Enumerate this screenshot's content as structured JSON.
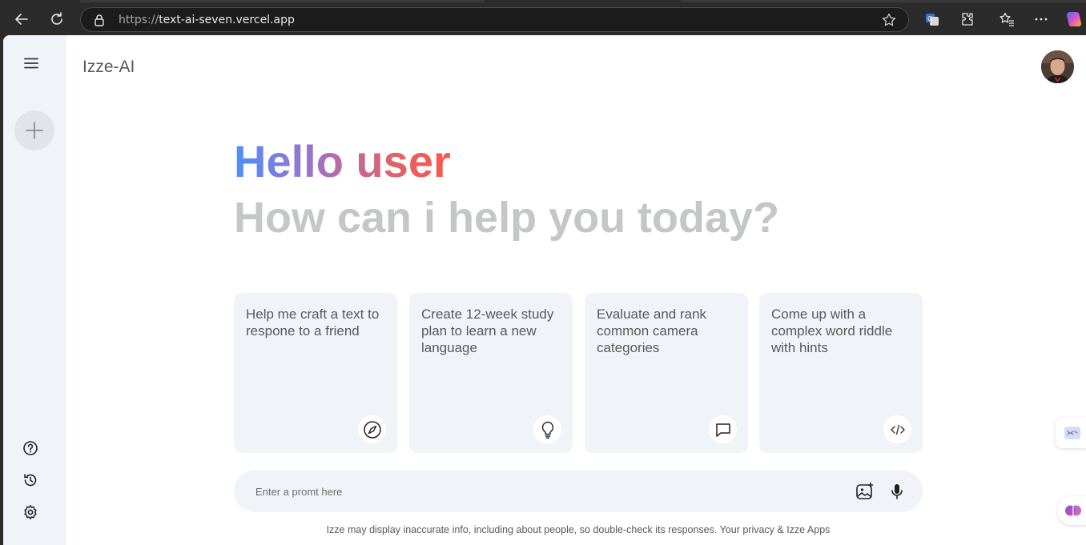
{
  "browser": {
    "url_protocol": "https://",
    "url_host": "text-ai-seven.vercel.app"
  },
  "app": {
    "brand": "Izze-AI"
  },
  "greeting": {
    "hello": "Hello user",
    "subtitle": "How can i help you today?"
  },
  "cards": [
    {
      "text": "Help me craft a text to respone to a friend",
      "icon": "compass-icon"
    },
    {
      "text": "Create 12-week study plan to learn a new language",
      "icon": "bulb-icon"
    },
    {
      "text": "Evaluate and rank common camera categories",
      "icon": "message-icon"
    },
    {
      "text": "Come up with a complex word riddle with hints",
      "icon": "code-icon"
    }
  ],
  "prompt": {
    "placeholder": "Enter a promt here"
  },
  "footer": {
    "disclaimer": "Izze may display inaccurate info, including about people, so double-check its responses. Your privacy & Izze Apps"
  },
  "colors": {
    "sidebar_bg": "#f0f4f9",
    "card_bg": "#f0f4f9",
    "subtitle": "#c4c7c5",
    "gradient": [
      "#4b90ff",
      "#9b72cb",
      "#d96570",
      "#ff5546"
    ]
  }
}
